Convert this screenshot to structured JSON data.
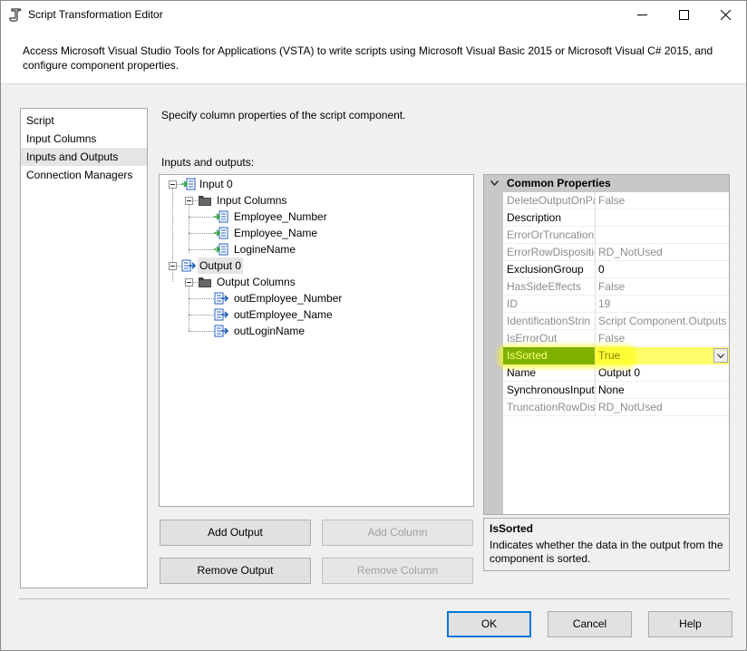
{
  "window": {
    "title": "Script Transformation Editor",
    "controls": {
      "minimize": "minimize",
      "maximize": "maximize",
      "close": "close"
    }
  },
  "banner": {
    "text": "Access Microsoft Visual Studio Tools for Applications (VSTA) to write scripts using Microsoft Visual Basic 2015 or Microsoft Visual C# 2015, and configure component properties."
  },
  "nav": {
    "items": [
      {
        "label": "Script"
      },
      {
        "label": "Input Columns"
      },
      {
        "label": "Inputs and Outputs",
        "selected": true
      },
      {
        "label": "Connection Managers"
      }
    ]
  },
  "main": {
    "description": "Specify column properties of the script component.",
    "io_label": "Inputs and outputs:"
  },
  "tree": {
    "input": "Input 0",
    "input_columns": "Input Columns",
    "input_cols": [
      "Employee_Number",
      "Employee_Name",
      "LogineName"
    ],
    "output": "Output 0",
    "output_columns": "Output Columns",
    "output_cols": [
      "outEmployee_Number",
      "outEmployee_Name",
      "outLoginName"
    ]
  },
  "properties": {
    "category": "Common Properties",
    "rows": [
      {
        "name": "DeleteOutputOnPa",
        "value": "False",
        "readonly": true
      },
      {
        "name": "Description",
        "value": "",
        "readonly": false
      },
      {
        "name": "ErrorOrTruncation",
        "value": "",
        "readonly": true
      },
      {
        "name": "ErrorRowDispositic",
        "value": "RD_NotUsed",
        "readonly": true
      },
      {
        "name": "ExclusionGroup",
        "value": "0",
        "readonly": false
      },
      {
        "name": "HasSideEffects",
        "value": "False",
        "readonly": true
      },
      {
        "name": "ID",
        "value": "19",
        "readonly": true
      },
      {
        "name": "IdentificationStrin",
        "value": "Script Component.Outputs",
        "readonly": true
      },
      {
        "name": "IsErrorOut",
        "value": "False",
        "readonly": true
      },
      {
        "name": "IsSorted",
        "value": "True",
        "readonly": false,
        "selected": true
      },
      {
        "name": "Name",
        "value": "Output 0",
        "readonly": false
      },
      {
        "name": "SynchronousInput",
        "value": "None",
        "readonly": false
      },
      {
        "name": "TruncationRowDis",
        "value": "RD_NotUsed",
        "readonly": true
      }
    ]
  },
  "help": {
    "title": "IsSorted",
    "body": "Indicates whether the data in the output from the component is sorted."
  },
  "buttons": {
    "add_output": "Add Output",
    "add_column": "Add Column",
    "remove_output": "Remove Output",
    "remove_column": "Remove Column",
    "ok": "OK",
    "cancel": "Cancel",
    "help": "Help"
  },
  "colors": {
    "selected_name_bg": "#006400",
    "selected_value_bg": "#fffd6a",
    "accent": "#0078d7",
    "folder_icon": "#444444",
    "column_icon_blue": "#1f5fbf",
    "column_icon_green": "#2e9e3b"
  }
}
